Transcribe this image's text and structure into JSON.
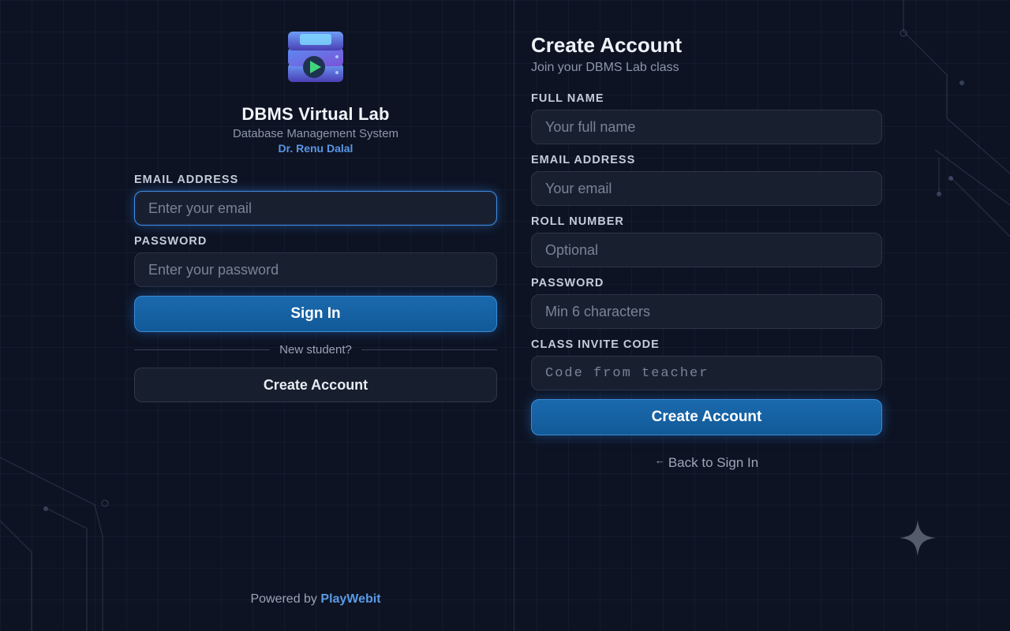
{
  "login": {
    "app_title": "DBMS Virtual Lab",
    "app_subtitle": "Database Management System",
    "author": "Dr. Renu Dalal",
    "email_label": "EMAIL ADDRESS",
    "email_placeholder": "Enter your email",
    "password_label": "PASSWORD",
    "password_placeholder": "Enter your password",
    "sign_in_label": "Sign In",
    "separator_text": "New student?",
    "create_account_label": "Create Account"
  },
  "footer": {
    "powered_prefix": "Powered by",
    "powered_brand": "PlayWebit"
  },
  "signup": {
    "title": "Create Account",
    "subtitle": "Join your DBMS Lab class",
    "full_name_label": "FULL NAME",
    "full_name_placeholder": "Your full name",
    "email_label": "EMAIL ADDRESS",
    "email_placeholder": "Your email",
    "roll_label": "ROLL NUMBER",
    "roll_placeholder": "Optional",
    "password_label": "PASSWORD",
    "password_placeholder": "Min 6 characters",
    "invite_label": "CLASS INVITE CODE",
    "invite_placeholder": "Code from teacher",
    "submit_label": "Create Account",
    "back_arrow": "←",
    "back_label": "Back to Sign In"
  },
  "icons": {
    "logo": "database-play-icon",
    "sparkle": "sparkle-icon",
    "back": "arrow-left-icon"
  },
  "colors": {
    "background": "#0c1220",
    "accent": "#1a69ad",
    "link": "#5a96e6"
  }
}
